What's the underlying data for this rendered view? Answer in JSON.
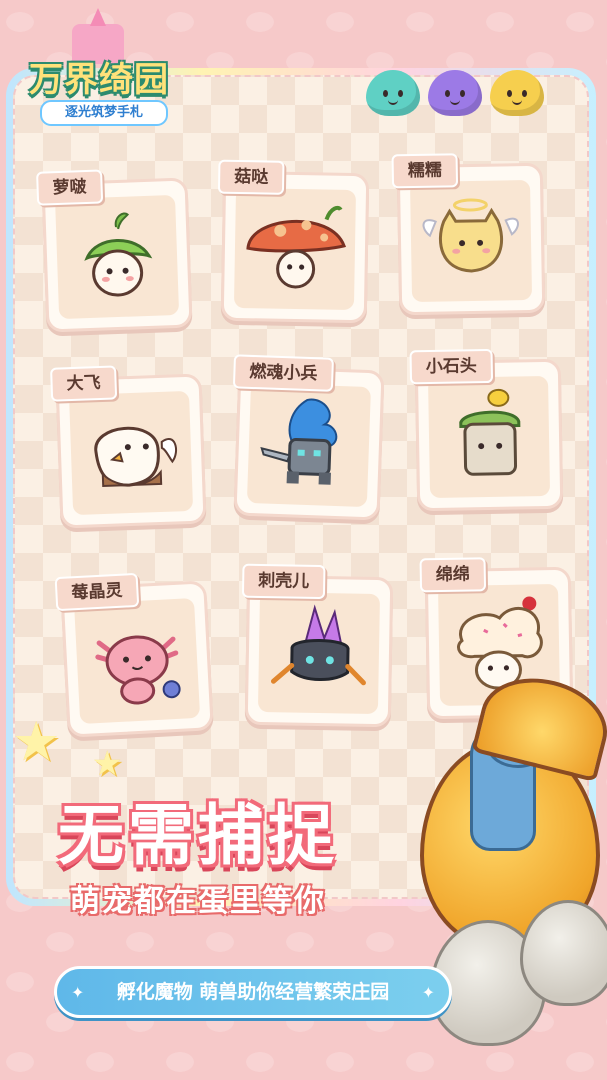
{
  "logo": {
    "title": "万界绮园",
    "subtitle": "逐光筑梦手札"
  },
  "slimes": [
    {
      "name": "teal-slime",
      "color": "#5fd0c4"
    },
    {
      "name": "purple-slime",
      "color": "#9c7ae6"
    },
    {
      "name": "yellow-slime",
      "color": "#f6cf4e"
    }
  ],
  "monsters": [
    {
      "label": "萝啵",
      "icon": "sprout-turnip-icon"
    },
    {
      "label": "菇哒",
      "icon": "mushroom-icon"
    },
    {
      "label": "糯糯",
      "icon": "angel-cat-icon"
    },
    {
      "label": "大飞",
      "icon": "eagle-chick-icon"
    },
    {
      "label": "燃魂小兵",
      "icon": "flame-knight-icon"
    },
    {
      "label": "小石头",
      "icon": "mossy-rock-icon"
    },
    {
      "label": "莓晶灵",
      "icon": "axolotl-icon"
    },
    {
      "label": "刺壳儿",
      "icon": "crystal-crab-icon"
    },
    {
      "label": "绵绵",
      "icon": "cream-cake-icon"
    }
  ],
  "headline": "无需捕捉",
  "subline": "萌宠都在蛋里等你",
  "banner": {
    "text": "孵化魔物 萌兽助你经营繁荣庄园"
  },
  "colors": {
    "background": "#f6c9c9",
    "headline_outline": "#f26a7a",
    "banner": "#5fb8e9"
  }
}
